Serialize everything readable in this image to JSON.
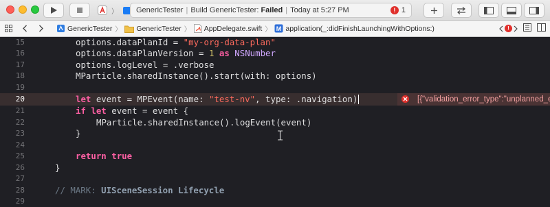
{
  "toolbar": {
    "activity": {
      "project": "GenericTester",
      "build_prefix": "Build GenericTester:",
      "build_status": "Failed",
      "timestamp": "Today at 5:27 PM",
      "error_count": "1"
    }
  },
  "jumpbar": {
    "crumbs": [
      "GenericTester",
      "GenericTester",
      "AppDelegate.swift",
      "application(_:didFinishLaunchingWithOptions:)"
    ]
  },
  "editor": {
    "line_numbers": [
      "15",
      "16",
      "17",
      "18",
      "19",
      "20",
      "21",
      "22",
      "23",
      "24",
      "25",
      "26",
      "27",
      "28",
      "29"
    ],
    "error_annotation": "[{\"validation_error_type\":\"unplanned_event\"",
    "code": {
      "l15_a": "options.dataPlanId = ",
      "l15_str": "\"my-org-data-plan\"",
      "l16_a": "options.dataPlanVersion = ",
      "l16_num": "1",
      "l16_as": "as",
      "l16_type": "NSNumber",
      "l17": "options.logLevel = .verbose",
      "l18": "MParticle.sharedInstance().start(with: options)",
      "l20_let": "let",
      "l20_a": " event = MPEvent(name: ",
      "l20_str": "\"test-nv\"",
      "l20_b": ", type: .navigation)",
      "l21_if": "if",
      "l21_let": "let",
      "l21_a": " event = event {",
      "l22": "MParticle.sharedInstance().logEvent(event)",
      "l23": "}",
      "l25_return": "return",
      "l25_true": "true",
      "l26": "}",
      "l28_cmt": "// MARK: ",
      "l28_mark": "UISceneSession Lifecycle"
    }
  },
  "colors": {
    "editor_bg": "#1f1f24",
    "keyword": "#fc5fa3",
    "string": "#fc6a5d",
    "number": "#d0bf69",
    "type": "#d0a8ff",
    "comment": "#6c7986",
    "error": "#e0302c"
  }
}
